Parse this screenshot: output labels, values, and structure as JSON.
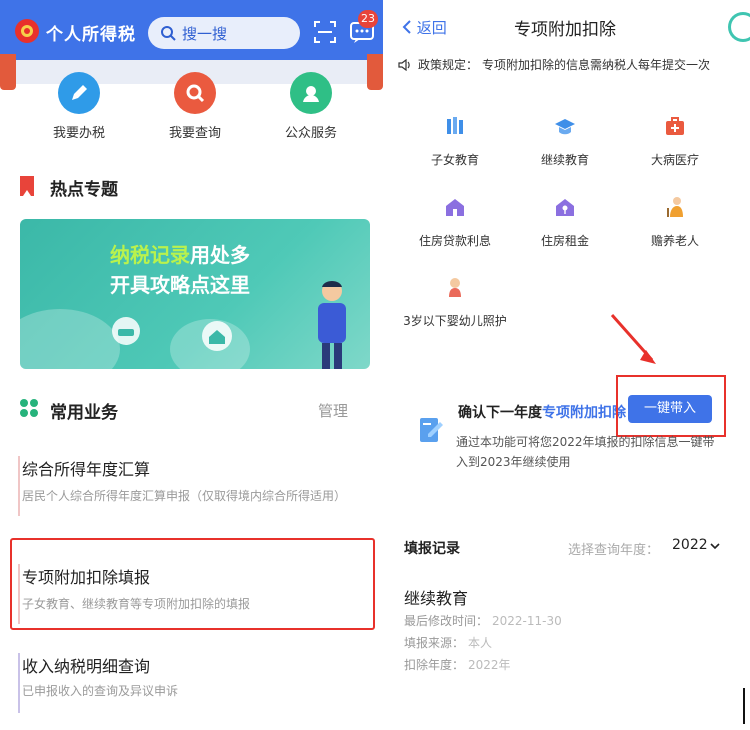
{
  "left": {
    "header": {
      "title": "个人所得税",
      "search_placeholder": "搜一搜",
      "notification_count": "23"
    },
    "quick_actions": [
      {
        "label": "我要办税",
        "icon": "pen-icon",
        "color": "#2f9be8"
      },
      {
        "label": "我要查询",
        "icon": "magnifier-icon",
        "color": "#ea5a3f"
      },
      {
        "label": "公众服务",
        "icon": "service-icon",
        "color": "#2fbf86"
      }
    ],
    "hot_topics": {
      "title": "热点专题",
      "banner_line1_green": "纳税记录",
      "banner_line1_rest": "用处多",
      "banner_line2": "开具攻略点这里"
    },
    "common_services": {
      "title": "常用业务",
      "manage_label": "管理",
      "items": [
        {
          "title": "综合所得年度汇算",
          "desc": "居民个人综合所得年度汇算申报（仅取得境内综合所得适用）"
        },
        {
          "title": "专项附加扣除填报",
          "desc": "子女教育、继续教育等专项附加扣除的填报"
        },
        {
          "title": "收入纳税明细查询",
          "desc": "已申报收入的查询及异议申诉"
        }
      ]
    }
  },
  "right": {
    "back_label": "返回",
    "title": "专项附加扣除",
    "policy_prefix": "政策规定：",
    "policy_text": "专项附加扣除的信息需纳税人每年提交一次",
    "categories": [
      {
        "label": "子女教育",
        "icon": "books-icon",
        "color": "#3f8fe8"
      },
      {
        "label": "继续教育",
        "icon": "graduation-cap-icon",
        "color": "#3f8fe8"
      },
      {
        "label": "大病医疗",
        "icon": "medical-kit-icon",
        "color": "#ea5a3f"
      },
      {
        "label": "住房贷款利息",
        "icon": "house-icon",
        "color": "#8b6fe0"
      },
      {
        "label": "住房租金",
        "icon": "key-house-icon",
        "color": "#8b6fe0"
      },
      {
        "label": "赡养老人",
        "icon": "elderly-icon",
        "color": "#f0a030"
      },
      {
        "label": "3岁以下婴幼儿照护",
        "icon": "baby-icon",
        "color": "#ea6a5a"
      }
    ],
    "confirm": {
      "prefix": "确认下一年度",
      "highlight": "专项附加扣除",
      "button_label": "一键带入",
      "desc": "通过本功能可将您2022年填报的扣除信息一键带入到2023年继续使用"
    },
    "records": {
      "title": "填报记录",
      "year_label": "选择查询年度：",
      "year_value": "2022",
      "item": {
        "name": "继续教育",
        "modified_label": "最后修改时间：",
        "modified_value": "2022-11-30",
        "source_label": "填报来源：",
        "source_value": "本人",
        "deduct_year_label": "扣除年度：",
        "deduct_year_value": "2022年"
      }
    }
  }
}
